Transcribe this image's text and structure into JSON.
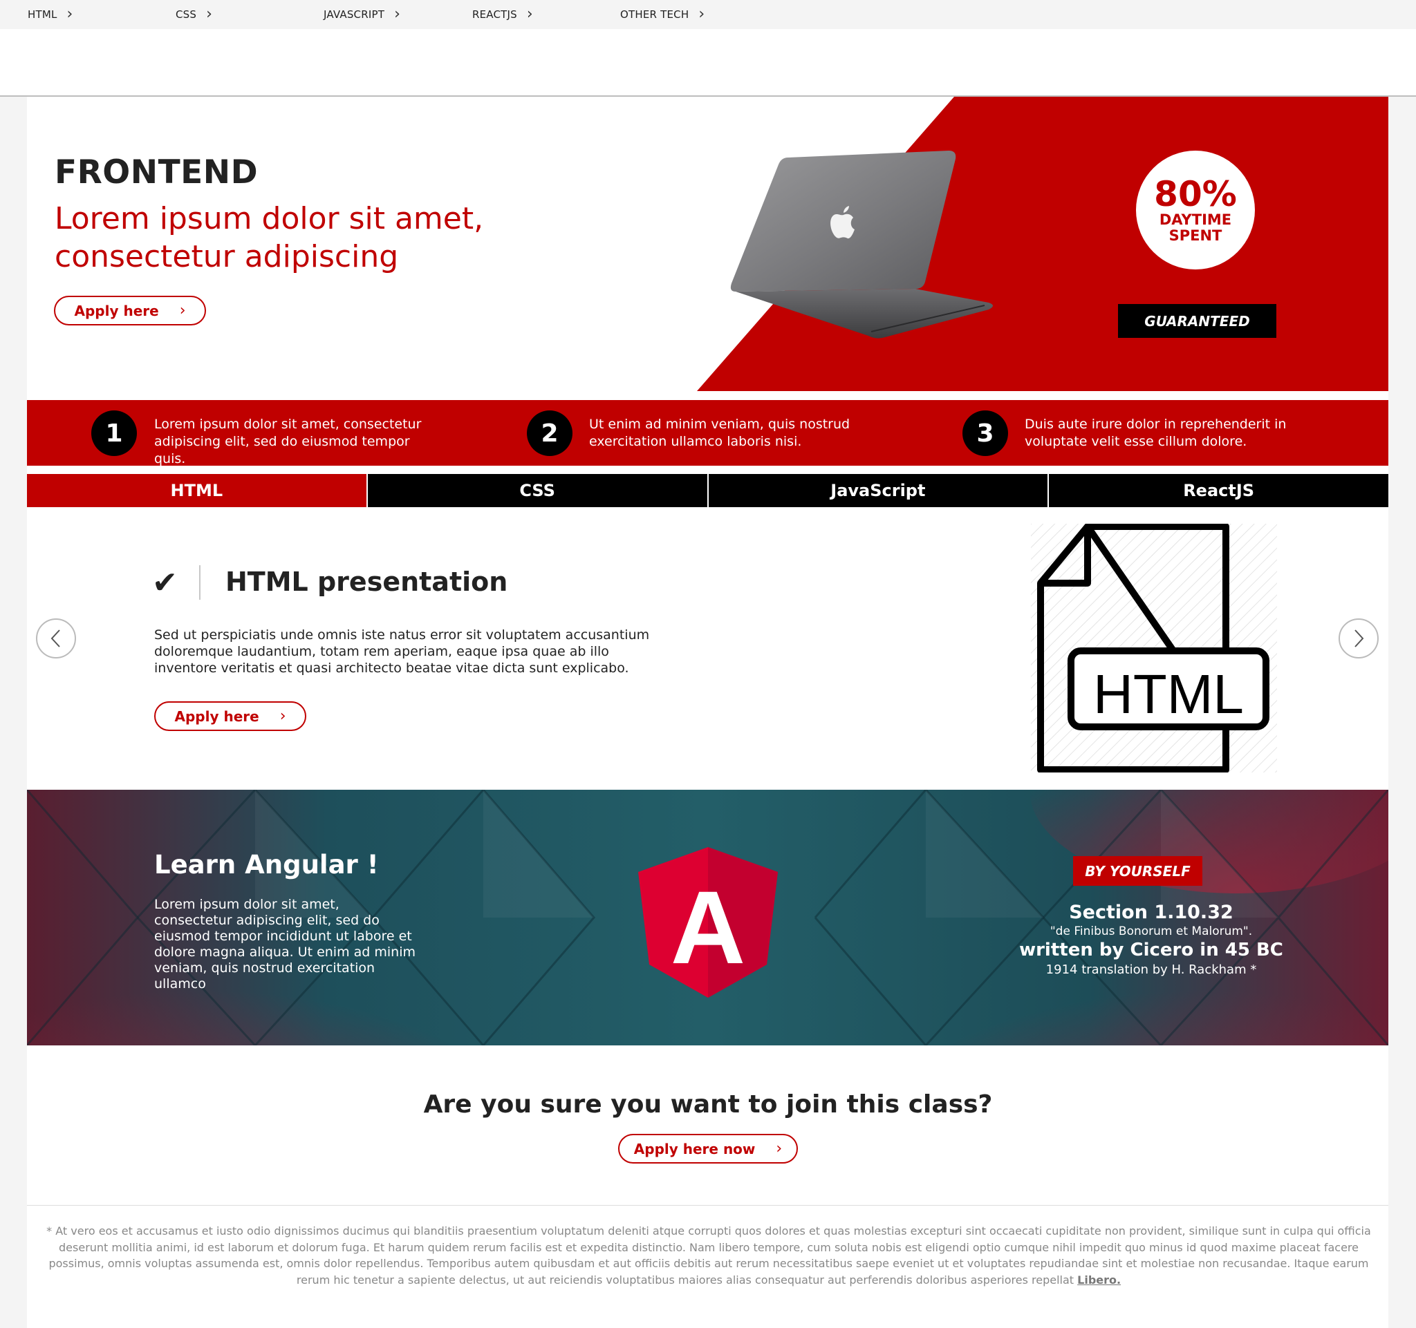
{
  "nav": {
    "items": [
      {
        "label": "HTML"
      },
      {
        "label": "CSS"
      },
      {
        "label": "JAVASCRIPT"
      },
      {
        "label": "REACTJS"
      },
      {
        "label": "OTHER TECH"
      }
    ]
  },
  "hero": {
    "title": "FRONTEND",
    "subtitle": "Lorem ipsum dolor sit amet, consectetur adipiscing",
    "apply_label": "Apply here",
    "badge_percent": "80%",
    "badge_line1": "DAYTIME",
    "badge_line2": "SPENT",
    "guaranteed": "GUARANTEED"
  },
  "steps": [
    {
      "num": "1",
      "text": "Lorem ipsum dolor sit amet, consectetur adipiscing elit, sed do eiusmod tempor quis."
    },
    {
      "num": "2",
      "text": "Ut enim ad minim veniam, quis nostrud exercitation ullamco laboris nisi."
    },
    {
      "num": "3",
      "text": "Duis aute irure dolor in reprehenderit in voluptate velit esse cillum dolore."
    }
  ],
  "tabs": [
    {
      "label": "HTML"
    },
    {
      "label": "CSS"
    },
    {
      "label": "JavaScript"
    },
    {
      "label": "ReactJS"
    }
  ],
  "presentation": {
    "check": "✔",
    "title": "HTML presentation",
    "body": "Sed ut perspiciatis unde omnis iste natus error sit voluptatem accusantium doloremque laudantium, totam rem aperiam, eaque ipsa quae ab illo inventore veritatis et quasi architecto beatae vitae dicta sunt explicabo.",
    "apply_label": "Apply here",
    "icon_text": "HTML"
  },
  "angular": {
    "title": "Learn Angular !",
    "body": "Lorem ipsum dolor sit amet, consectetur adipiscing elit, sed do eiusmod tempor incididunt ut labore et dolore magna aliqua. Ut enim ad minim veniam, quis nostrud exercitation ullamco",
    "logo_letter": "A",
    "badge": "BY YOURSELF",
    "section": "Section 1.10.32",
    "quote": "\"de Finibus Bonorum et Malorum\".",
    "written": "written by Cicero in 45 BC",
    "translation": "1914 translation by H. Rackham *"
  },
  "cta": {
    "title": "Are you sure you want to join this class?",
    "apply_label": "Apply here now"
  },
  "footnote": {
    "text": "* At vero eos et accusamus et iusto odio dignissimos ducimus qui blanditiis praesentium voluptatum deleniti atque corrupti quos dolores et quas molestias excepturi sint occaecati cupiditate non provident, similique sunt in culpa qui officia deserunt mollitia animi, id est laborum et dolorum fuga. Et harum quidem rerum facilis est et expedita distinctio. Nam libero tempore, cum soluta nobis est eligendi optio cumque nihil impedit quo minus id quod maxime placeat facere possimus, omnis voluptas assumenda est, omnis dolor repellendus. Temporibus autem quibusdam et aut officiis debitis aut rerum necessitatibus saepe eveniet ut et voluptates repudiandae sint et molestiae non recusandae. Itaque earum rerum hic tenetur a sapiente delectus, ut aut reiciendis voluptatibus maiores alias consequatur aut perferendis doloribus asperiores repellat ",
    "link": "Libero."
  },
  "colors": {
    "brand_red": "#c00000",
    "angular_red": "#dd0031",
    "teal": "#1f5a66",
    "maroon": "#6d1f33"
  }
}
